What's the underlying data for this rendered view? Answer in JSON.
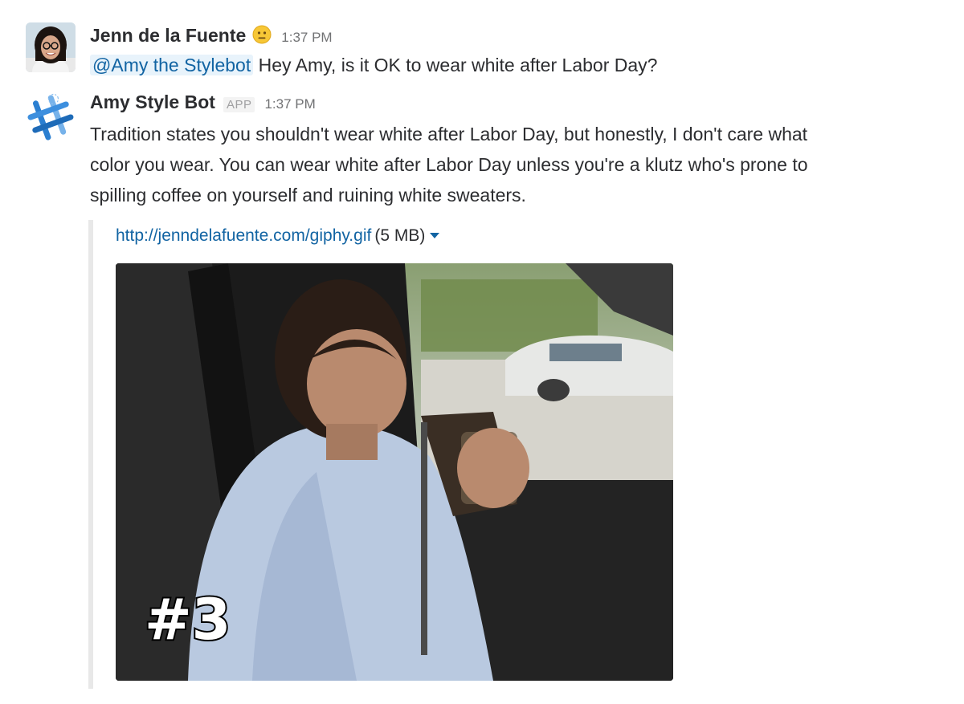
{
  "messages": [
    {
      "sender": "Jenn de la Fuente",
      "status_emoji": "neutral-face-icon",
      "timestamp": "1:37 PM",
      "mention": "@Amy the Stylebot",
      "text": "Hey Amy, is it OK to wear white after Labor Day?"
    },
    {
      "sender": "Amy Style Bot",
      "badge": "APP",
      "timestamp": "1:37 PM",
      "text_lines": [
        "Tradition states you shouldn't wear white after Labor Day, but honestly, I don't care what",
        "color you wear. You can wear white after Labor Day unless you're a klutz who's prone to",
        "spilling coffee on yourself and ruining white sweaters."
      ],
      "attachment": {
        "url": "http://jenndelafuente.com/giphy.gif",
        "size": "(5 MB)",
        "image_caption": "#3"
      }
    }
  ],
  "colors": {
    "link": "#1264a3",
    "mention_bg": "#e8f3fb",
    "text": "#2c2d30",
    "timestamp": "#717274",
    "attachment_border": "#e8e8e8"
  }
}
